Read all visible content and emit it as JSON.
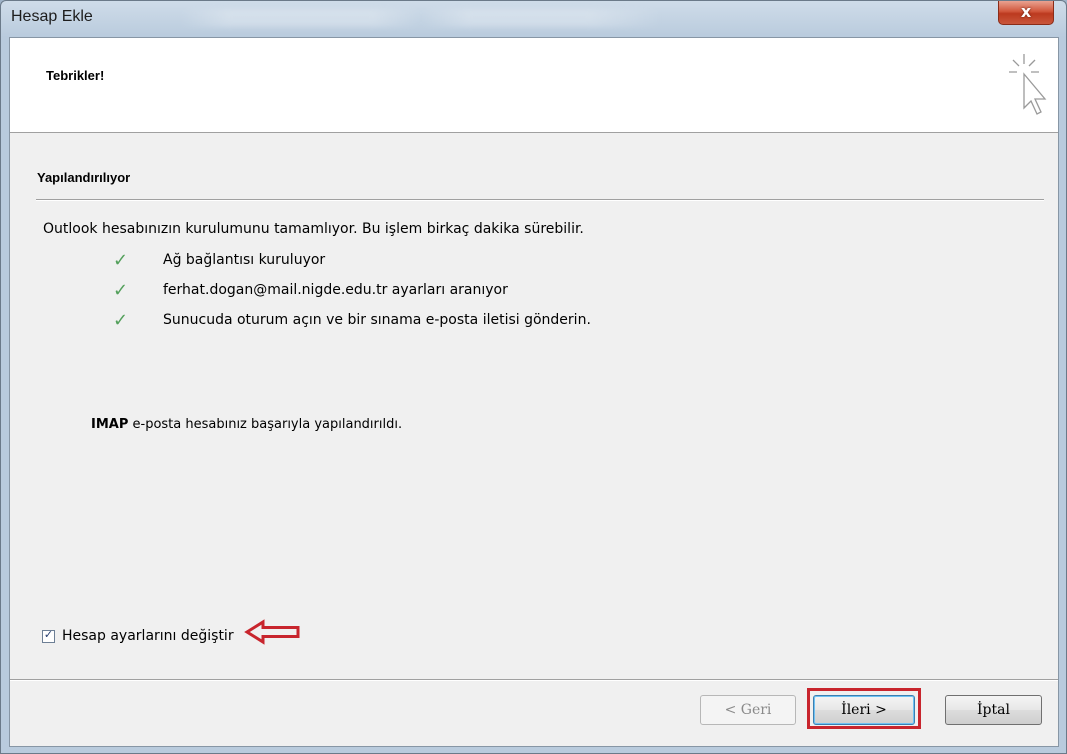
{
  "window": {
    "title": "Hesap Ekle",
    "close_label": "x"
  },
  "header": {
    "title": "Tebrikler!",
    "icon": "wizard-cursor-icon"
  },
  "section": {
    "title": "Yapılandırılıyor",
    "intro": "Outlook hesabınızın kurulumunu tamamlıyor. Bu işlem birkaç dakika sürebilir."
  },
  "tasks": [
    {
      "label": "Ağ bağlantısı kuruluyor",
      "status": "done"
    },
    {
      "label": "ferhat.dogan@mail.nigde.edu.tr ayarları aranıyor",
      "status": "done"
    },
    {
      "label": "Sunucuda oturum açın ve bir sınama e-posta iletisi gönderin.",
      "status": "done"
    }
  ],
  "result": {
    "protocol": "IMAP",
    "message": " e-posta hesabınız başarıyla yapılandırıldı."
  },
  "options": {
    "change_settings_label": "Hesap ayarlarını değiştir",
    "change_settings_checked": true
  },
  "buttons": {
    "back": "< Geri",
    "next": "İleri >",
    "cancel": "İptal"
  },
  "colors": {
    "check": "#54a05c",
    "annotation": "#c8252d"
  }
}
